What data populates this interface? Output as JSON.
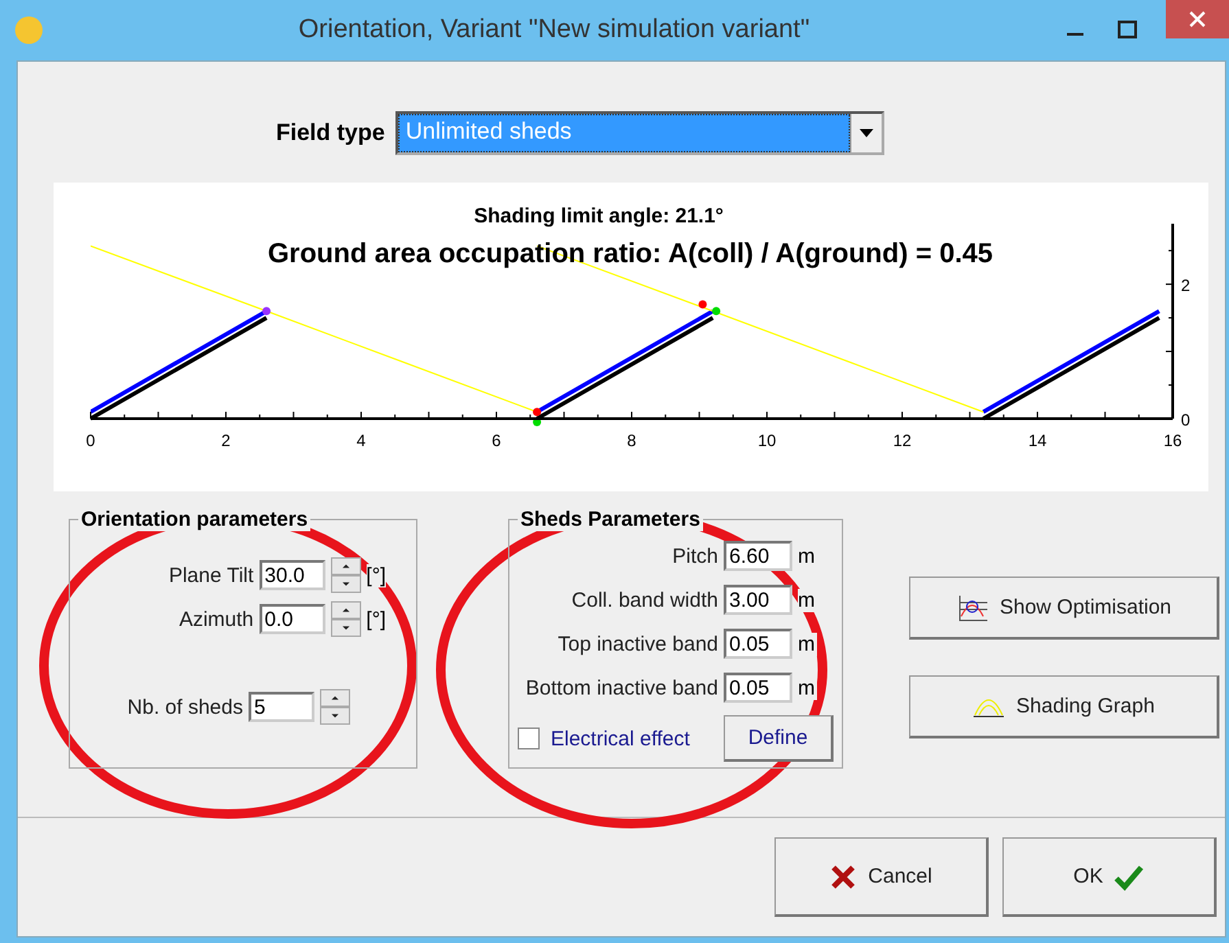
{
  "window": {
    "title": "Orientation, Variant \"New simulation variant\""
  },
  "field_type": {
    "label": "Field type",
    "value": "Unlimited sheds"
  },
  "chart": {
    "subtitle": "Shading limit angle:  21.1°",
    "title": "Ground area occupation ratio:  A(coll) / A(ground) = 0.45",
    "chart_data": {
      "type": "line",
      "x": [
        0,
        2.6,
        4.6,
        6.6,
        9.2,
        11.2,
        13.2,
        15.8
      ],
      "xlim": [
        0,
        16
      ],
      "ylim": [
        0,
        2.9
      ],
      "xticks": [
        0,
        2,
        4,
        6,
        8,
        10,
        12,
        14,
        16
      ],
      "yticks": [
        0,
        2
      ],
      "series": [
        {
          "color": "#0000ff",
          "values": [
            0.1,
            1.6,
            null,
            0.1,
            1.6,
            null,
            0.1,
            1.6
          ]
        },
        {
          "color": "#000000",
          "values": [
            0,
            1.5,
            null,
            0,
            1.5,
            null,
            0,
            1.5
          ]
        },
        {
          "color": "#ffff00",
          "values": [
            2.57,
            1.6,
            0.85,
            0.1,
            null,
            null,
            null,
            null
          ]
        },
        {
          "color": "#ffff00",
          "values": [
            null,
            null,
            null,
            2.57,
            1.6,
            0.85,
            0.1,
            null
          ]
        }
      ]
    }
  },
  "orientation_parameters": {
    "title": "Orientation parameters",
    "fields": [
      {
        "kind": "spin",
        "label": "Plane Tilt",
        "value": "30.0",
        "unit": "[°]"
      },
      {
        "kind": "spin",
        "label": "Azimuth",
        "value": "0.0",
        "unit": "[°]"
      },
      {
        "kind": "spin",
        "label": "Nb. of sheds",
        "value": "5"
      }
    ]
  },
  "sheds_parameters": {
    "title": "Sheds Parameters",
    "fields": [
      {
        "kind": "text",
        "label": "Pitch",
        "value": "6.60",
        "unit": "m"
      },
      {
        "kind": "text",
        "label": "Coll. band width",
        "value": "3.00",
        "unit": "m"
      },
      {
        "kind": "text",
        "label": "Top inactive band",
        "value": "0.05",
        "unit": "m"
      },
      {
        "kind": "text",
        "label": "Bottom inactive band",
        "value": "0.05",
        "unit": "m"
      }
    ],
    "electrical_effect": {
      "label": "Electrical effect",
      "checked": false
    },
    "define_button": "Define"
  },
  "side_buttons": [
    {
      "kind": "optimisation",
      "label": "Show Optimisation"
    },
    {
      "kind": "shading",
      "label": "Shading Graph"
    }
  ],
  "footer_buttons": [
    {
      "kind": "cancel",
      "label": "Cancel"
    },
    {
      "kind": "ok",
      "label": "OK"
    }
  ]
}
